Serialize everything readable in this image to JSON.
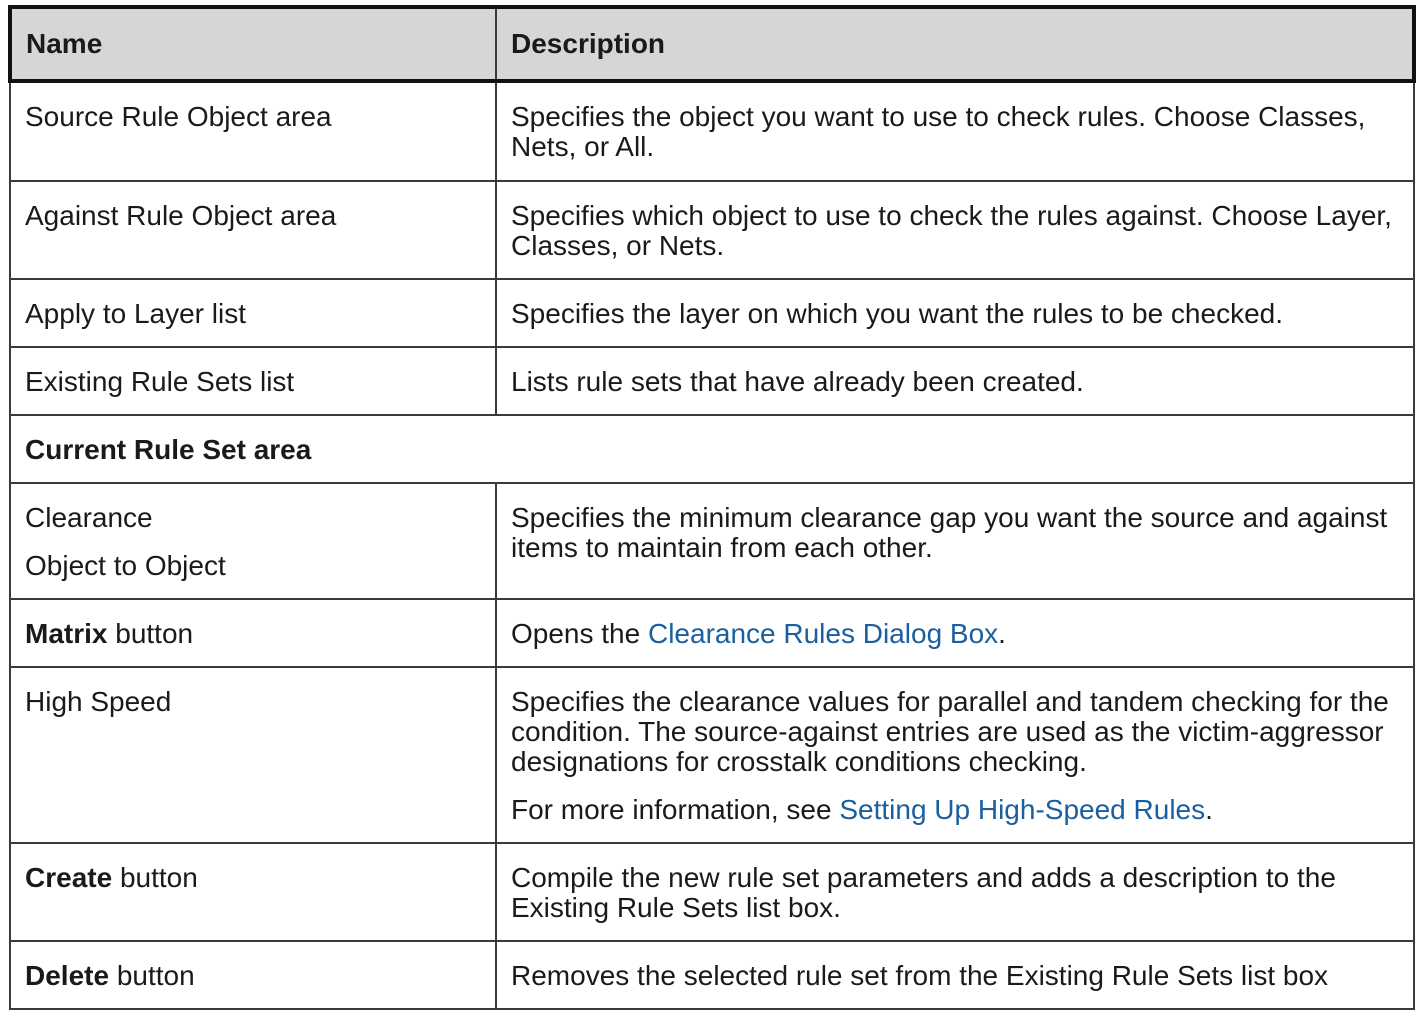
{
  "header": {
    "name": "Name",
    "description": "Description"
  },
  "rows": {
    "source_rule": {
      "name": "Source Rule Object area",
      "desc": "Specifies the object you want to use to check rules. Choose Classes, Nets, or All."
    },
    "against_rule": {
      "name": "Against Rule Object area",
      "desc": "Specifies which object to use to check the rules against. Choose Layer, Classes, or Nets."
    },
    "apply_layer": {
      "name": "Apply to Layer list",
      "desc": "Specifies the layer on which you want the rules to be checked."
    },
    "existing_sets": {
      "name": "Existing Rule Sets list",
      "desc": "Lists rule sets that have already been created."
    },
    "current_set_section": {
      "title": "Current Rule Set area"
    },
    "clearance": {
      "name_line1": "Clearance",
      "name_line2": "Object to Object",
      "desc": "Specifies the minimum clearance gap you want the source and against items to maintain from each other."
    },
    "matrix": {
      "name_bold": "Matrix",
      "name_rest": " button",
      "desc_prefix": "Opens the ",
      "desc_link": "Clearance Rules Dialog Box",
      "desc_suffix": "."
    },
    "high_speed": {
      "name": "High Speed",
      "desc": "Specifies the clearance values for parallel and tandem checking for the condition. The source-against entries are used as the victim-aggressor designations for crosstalk conditions checking.",
      "more_prefix": "For more information, see ",
      "more_link": "Setting Up High-Speed Rules",
      "more_suffix": "."
    },
    "create": {
      "name_bold": "Create",
      "name_rest": " button",
      "desc": "Compile the new rule set parameters and adds a description to the Existing Rule Sets list box."
    },
    "delete": {
      "name_bold": "Delete",
      "name_rest": " button",
      "desc": "Removes the selected rule set from the Existing Rule Sets list box"
    }
  }
}
